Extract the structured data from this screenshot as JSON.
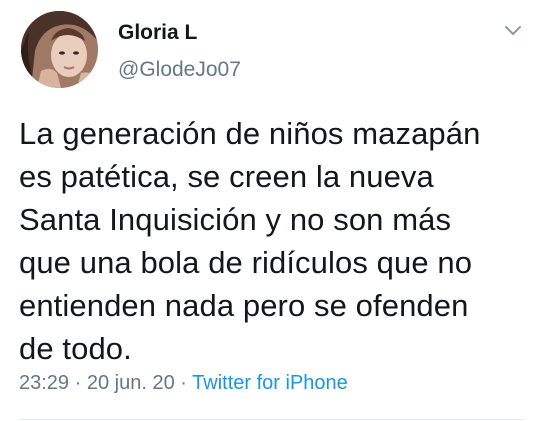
{
  "author": {
    "display_name": "Gloria L",
    "handle": "@GlodeJo07",
    "avatar_icon": "profile-photo"
  },
  "menu": {
    "icon": "chevron-down-icon"
  },
  "tweet": {
    "lines": [
      "La generación de niños mazapán",
      "es patética, se creen la nueva",
      "Santa Inquisición y no son más",
      "que una bola de ridículos que no",
      "entienden nada pero se ofenden",
      "de todo."
    ],
    "time": "23:29",
    "separator": "·",
    "date": "20 jun. 20",
    "source": "Twitter for iPhone"
  },
  "colors": {
    "text": "#14171a",
    "secondary": "#657786",
    "link": "#1b95e0",
    "divider": "#e1e8ed"
  }
}
